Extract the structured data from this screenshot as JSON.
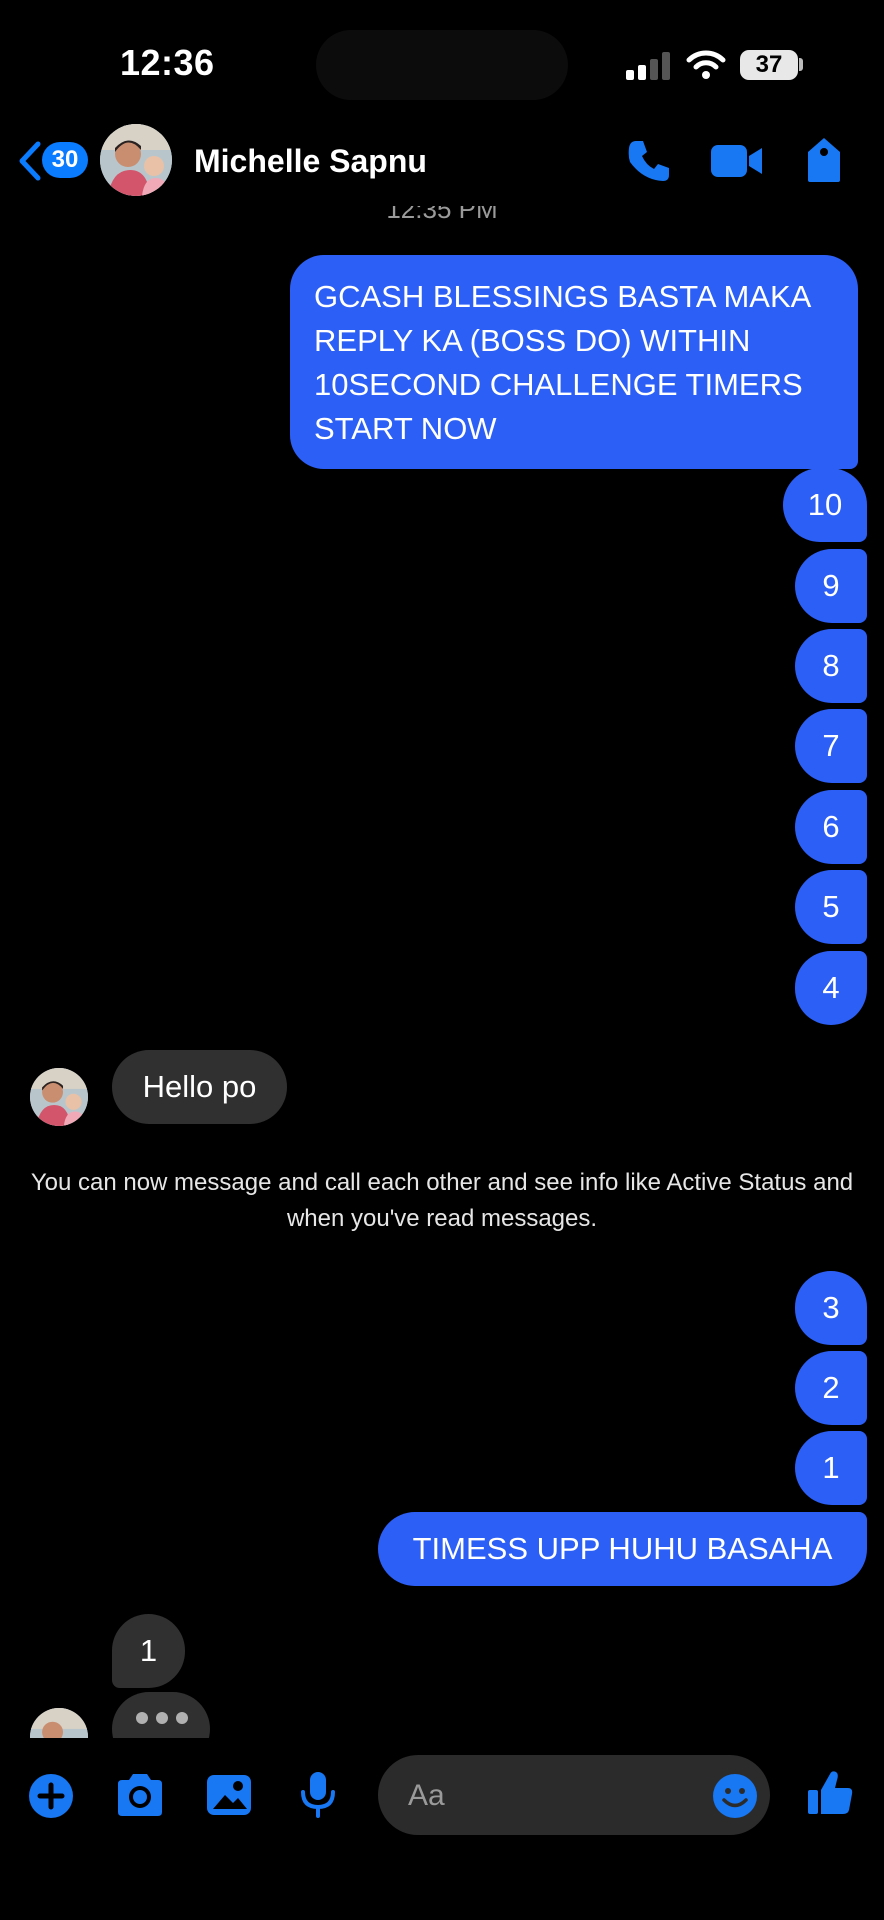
{
  "status_bar": {
    "time": "12:36",
    "battery": "37"
  },
  "header": {
    "back_count": "30",
    "contact_name": "Michelle Sapnu",
    "icons": [
      "back-chevron-icon",
      "phone-icon",
      "video-camera-icon",
      "tag-icon"
    ]
  },
  "timestamp_partial": "12:35 PM",
  "messages": {
    "m1": "GCASH BLESSINGS BASTA MAKA REPLY KA (BOSS DO) WITHIN 10SECOND CHALLENGE TIMERS START NOW",
    "n10": "10",
    "n9": "9",
    "n8": "8",
    "n7": "7",
    "n6": "6",
    "n5": "5",
    "n4": "4",
    "in1": "Hello po",
    "notice": "You can now message and call each other and see info like Active Status and when you've read messages.",
    "n3": "3",
    "n2": "2",
    "n1": "1",
    "m2": "TIMESS UPP HUHU BASAHA",
    "in2": "1"
  },
  "composer": {
    "placeholder": "Aa"
  },
  "toolbar_icons": [
    "plus-icon",
    "camera-icon",
    "gallery-icon",
    "microphone-icon",
    "emoji-icon",
    "thumbs-up-icon"
  ],
  "colors": {
    "accent": "#2c5ff6",
    "icon_blue": "#1877f2",
    "incoming_bubble": "#303030",
    "background": "#000000"
  }
}
